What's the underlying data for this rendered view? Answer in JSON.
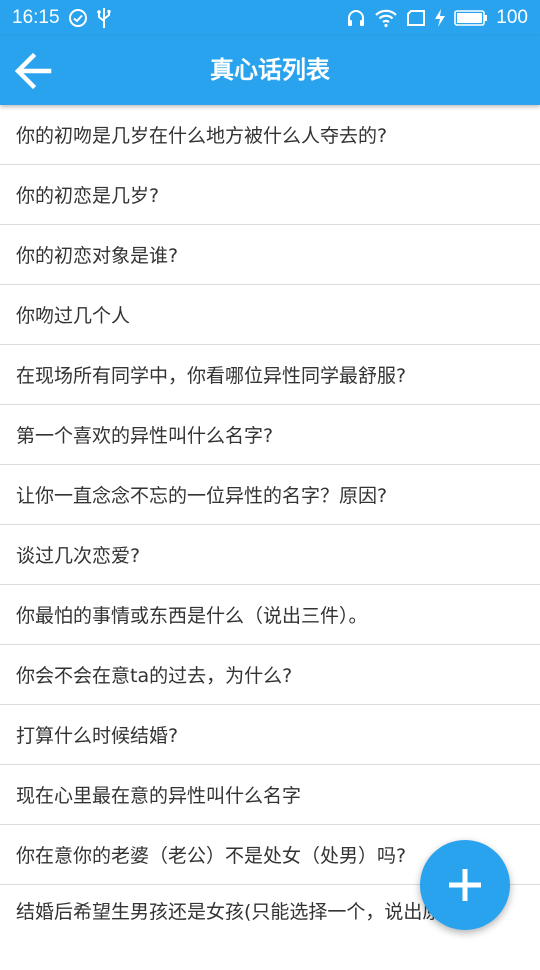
{
  "status_bar": {
    "time": "16:15",
    "battery": "100"
  },
  "app_bar": {
    "title": "真心话列表",
    "back_icon": "arrow-back-icon"
  },
  "questions": [
    "你的初吻是几岁在什么地方被什么人夺去的?",
    "你的初恋是几岁?",
    "你的初恋对象是谁?",
    "你吻过几个人",
    "在现场所有同学中，你看哪位异性同学最舒服?",
    "第一个喜欢的异性叫什么名字?",
    "让你一直念念不忘的一位异性的名字？原因?",
    "谈过几次恋爱?",
    "你最怕的事情或东西是什么（说出三件）。",
    "你会不会在意ta的过去，为什么?",
    "打算什么时候结婚?",
    "现在心里最在意的异性叫什么名字",
    "你在意你的老婆（老公）不是处女（处男）吗?",
    "结婚后希望生男孩还是女孩(只能选择一个，说出原因)。"
  ],
  "fab": {
    "icon": "plus-icon"
  },
  "colors": {
    "primary": "#2aa3ef",
    "text": "#333333",
    "divider": "#dcdcdc"
  }
}
